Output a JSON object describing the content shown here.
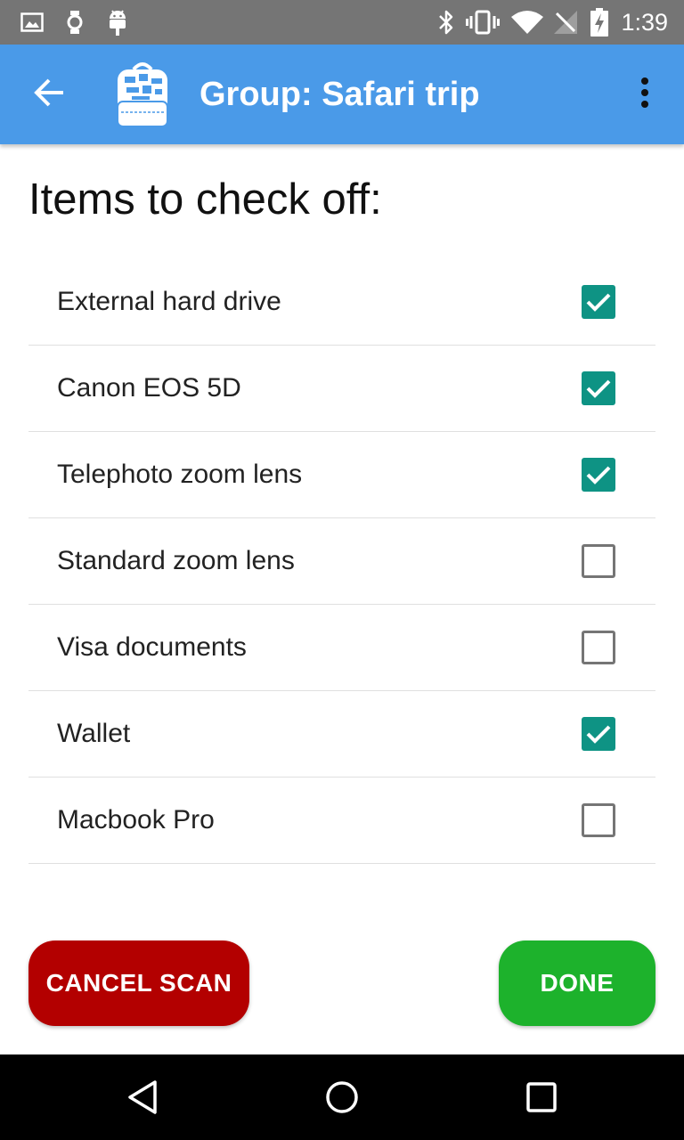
{
  "status_bar": {
    "time": "1:39",
    "icons": [
      "image-icon",
      "watch-icon",
      "android-icon",
      "bluetooth-icon",
      "vibrate-icon",
      "wifi-icon",
      "no-signal-icon",
      "battery-charging-icon"
    ]
  },
  "app_bar": {
    "title": "Group: Safari trip",
    "back_icon": "arrow-back-icon",
    "logo_icon": "backpack-icon",
    "menu_icon": "more-vert-icon",
    "color": "#4a9ae8"
  },
  "heading": "Items to check off:",
  "items": [
    {
      "label": "External hard drive",
      "checked": true
    },
    {
      "label": "Canon EOS 5D",
      "checked": true
    },
    {
      "label": "Telephoto zoom lens",
      "checked": true
    },
    {
      "label": "Standard zoom lens",
      "checked": false
    },
    {
      "label": "Visa documents",
      "checked": false
    },
    {
      "label": "Wallet",
      "checked": true
    },
    {
      "label": "Macbook Pro",
      "checked": false
    }
  ],
  "buttons": {
    "cancel": {
      "label": "CANCEL SCAN",
      "color": "#b30000"
    },
    "done": {
      "label": "DONE",
      "color": "#1db22c"
    }
  },
  "checkbox_color": "#0e9384",
  "nav_bar": {
    "icons": [
      "nav-back-icon",
      "nav-home-icon",
      "nav-recents-icon"
    ]
  }
}
